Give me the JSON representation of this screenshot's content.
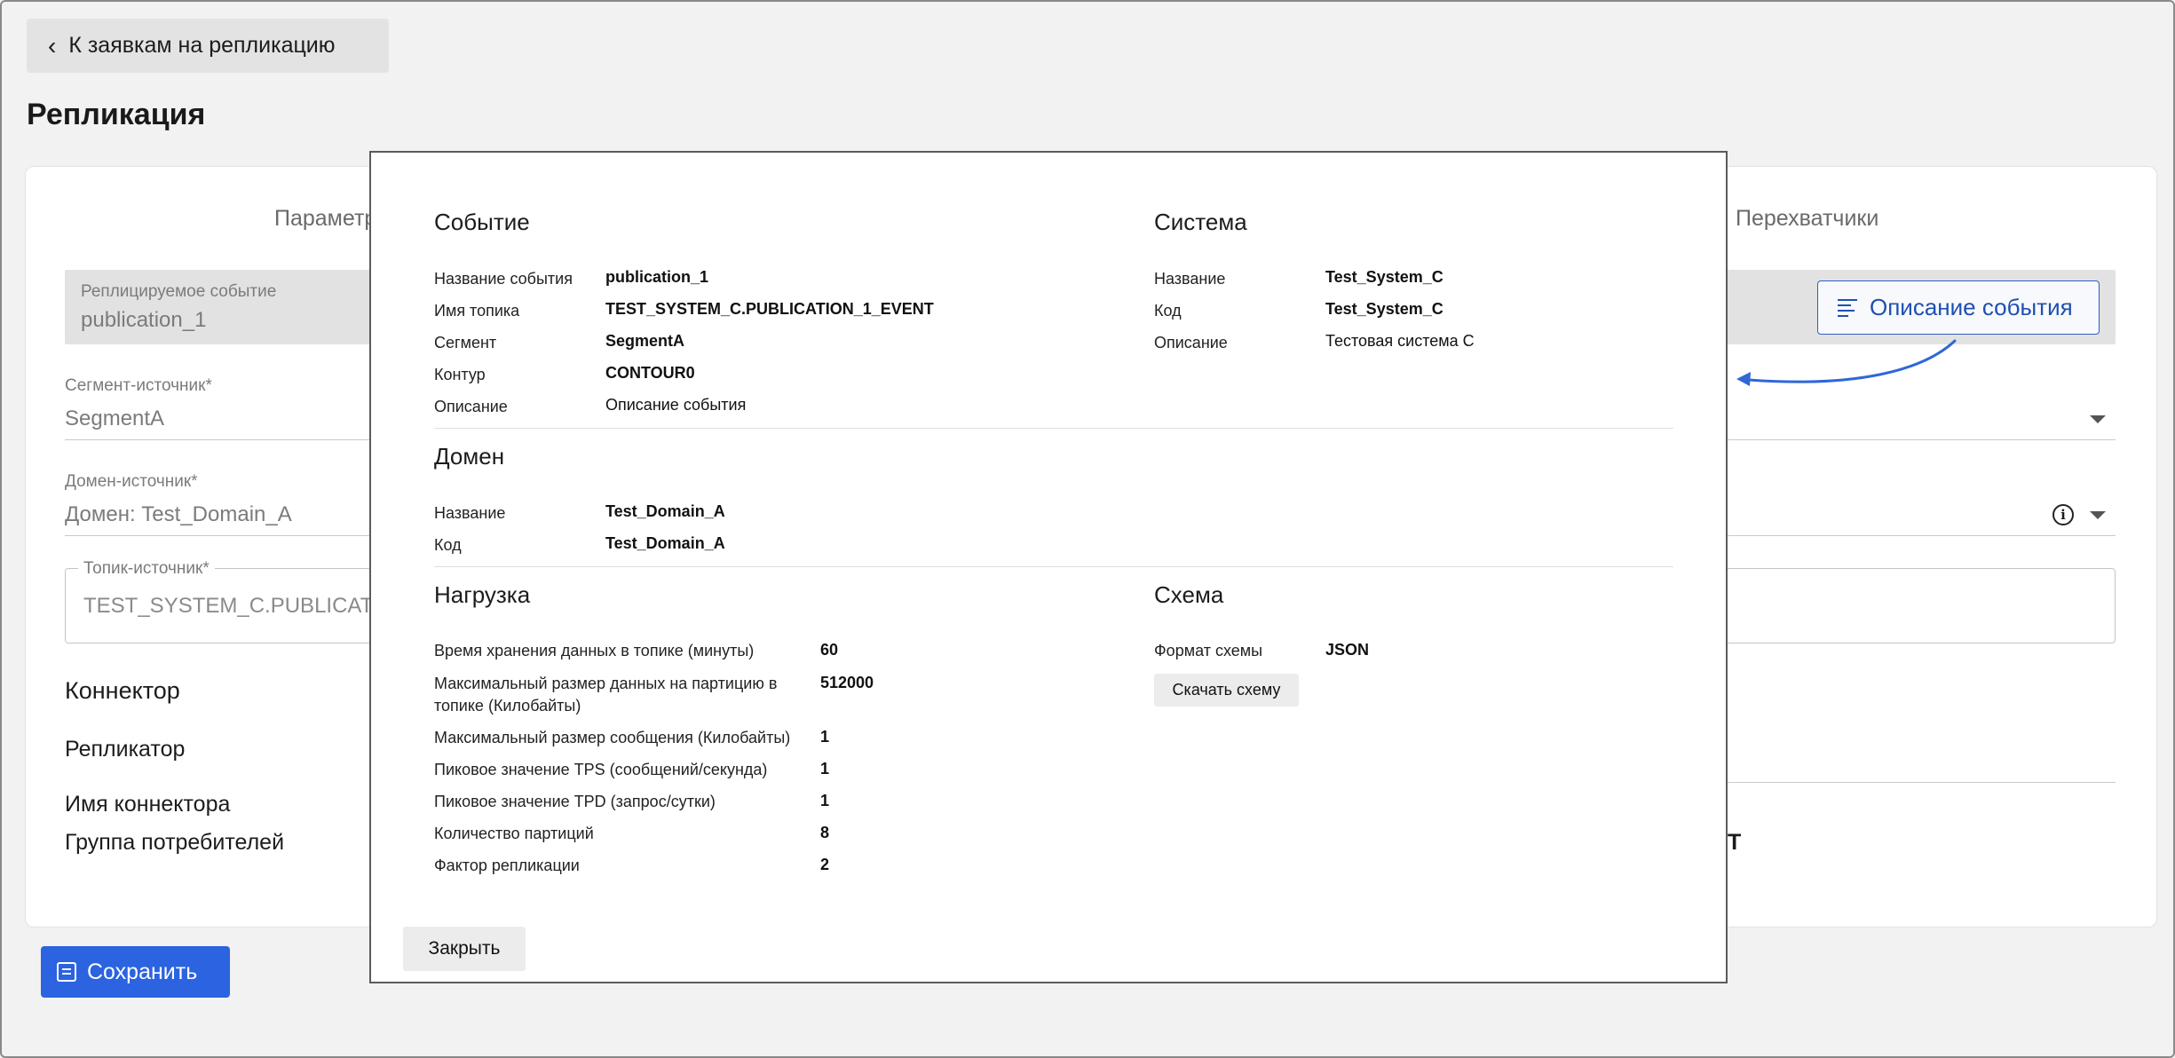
{
  "nav": {
    "back_label": "К заявкам на репликацию"
  },
  "page": {
    "title": "Репликация"
  },
  "tabs": {
    "params": "Параметр",
    "interceptors": "Перехватчики"
  },
  "form": {
    "replicated_event": {
      "label": "Реплицируемое событие",
      "value": "publication_1"
    },
    "description_button": "Описание события",
    "source_segment": {
      "label": "Сегмент-источник",
      "required_mark": "*",
      "value": "SegmentA"
    },
    "source_domain": {
      "label": "Домен-источник",
      "required_mark": "*",
      "value": "Домен: Test_Domain_A"
    },
    "source_topic": {
      "label": "Топик-источник",
      "required_mark": "*",
      "value": "TEST_SYSTEM_C.PUBLICAT"
    },
    "connector_heading": "Коннектор",
    "replicator_label": "Репликатор",
    "connector_name_label": "Имя коннектора",
    "consumer_group_label": "Группа потребителей",
    "consumer_group_value_fragment": "T"
  },
  "actions": {
    "save_label": "Сохранить"
  },
  "modal": {
    "event": {
      "heading": "Событие",
      "rows": [
        {
          "key": "Название события",
          "value": "publication_1",
          "bold": true
        },
        {
          "key": "Имя топика",
          "value": "TEST_SYSTEM_C.PUBLICATION_1_EVENT",
          "bold": true
        },
        {
          "key": "Сегмент",
          "value": "SegmentA",
          "bold": true
        },
        {
          "key": "Контур",
          "value": "CONTOUR0",
          "bold": true
        },
        {
          "key": "Описание",
          "value": "Описание события",
          "bold": false
        }
      ]
    },
    "system": {
      "heading": "Система",
      "rows": [
        {
          "key": "Название",
          "value": "Test_System_C",
          "bold": true
        },
        {
          "key": "Код",
          "value": "Test_System_C",
          "bold": true
        },
        {
          "key": "Описание",
          "value": "Тестовая система С",
          "bold": false
        }
      ]
    },
    "domain": {
      "heading": "Домен",
      "rows": [
        {
          "key": "Название",
          "value": "Test_Domain_A"
        },
        {
          "key": "Код",
          "value": "Test_Domain_A"
        }
      ]
    },
    "load": {
      "heading": "Нагрузка",
      "rows": [
        {
          "key": "Время хранения данных в топике (минуты)",
          "value": "60"
        },
        {
          "key": "Максимальный размер данных на партицию в топике (Килобайты)",
          "value": "512000"
        },
        {
          "key": "Максимальный размер сообщения (Килобайты)",
          "value": "1"
        },
        {
          "key": "Пиковое значение TPS (сообщений/секунда)",
          "value": "1"
        },
        {
          "key": "Пиковое значение TPD (запрос/сутки)",
          "value": "1"
        },
        {
          "key": "Количество партиций",
          "value": "8"
        },
        {
          "key": "Фактор репликации",
          "value": "2"
        }
      ]
    },
    "schema": {
      "heading": "Схема",
      "format_key": "Формат схемы",
      "format_value": "JSON",
      "download_label": "Скачать схему"
    },
    "close_label": "Закрыть"
  },
  "colors": {
    "accent": "#2b63e0",
    "annotation_arrow": "#2f67d8"
  }
}
